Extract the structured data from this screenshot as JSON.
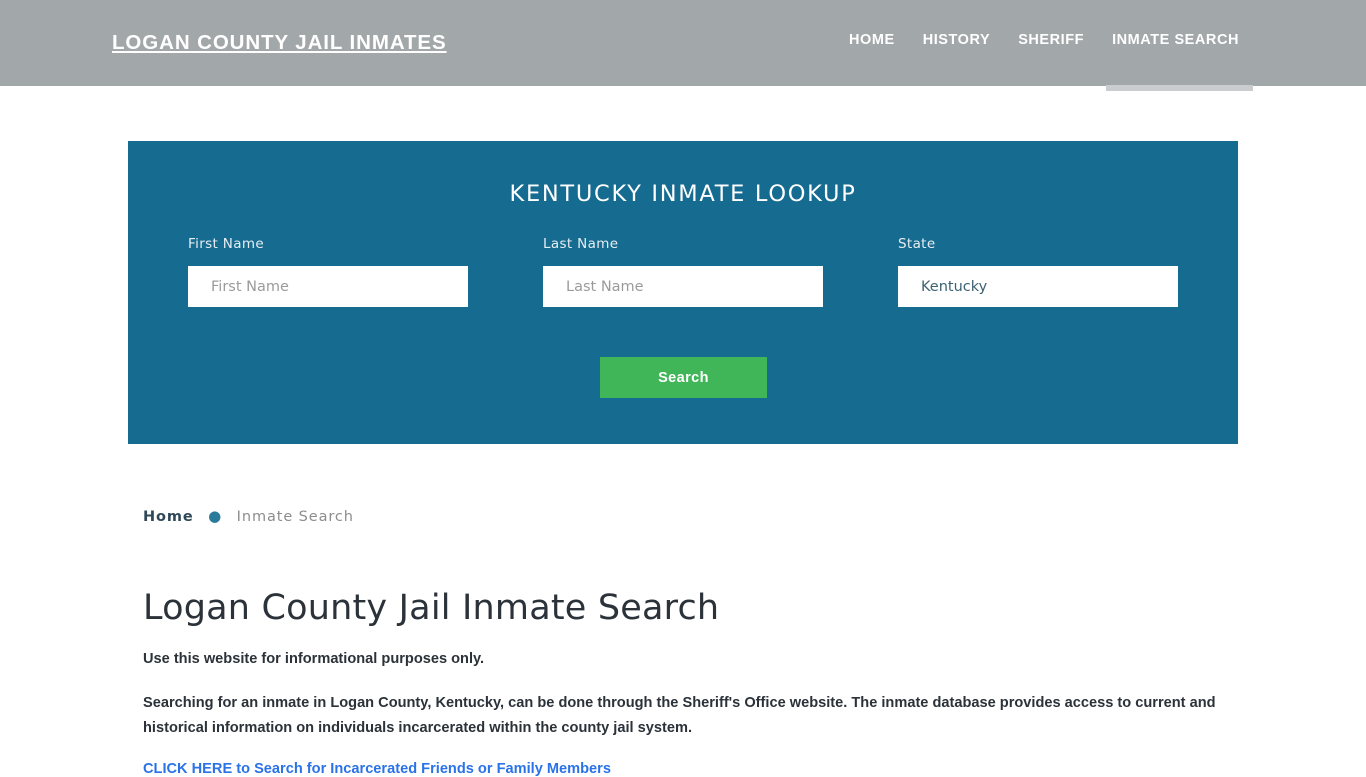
{
  "header": {
    "brand": "LOGAN COUNTY JAIL INMATES",
    "background_color": "#a2a7aa",
    "nav": [
      {
        "label": "HOME",
        "active": false
      },
      {
        "label": "HISTORY",
        "active": false
      },
      {
        "label": "SHERIFF",
        "active": false
      },
      {
        "label": "INMATE SEARCH",
        "active": true
      }
    ]
  },
  "lookup_panel": {
    "title": "KENTUCKY INMATE LOOKUP",
    "background_color": "#166b91",
    "fields": {
      "first_name": {
        "label": "First Name",
        "placeholder": "First Name",
        "value": ""
      },
      "last_name": {
        "label": "Last Name",
        "placeholder": "Last Name",
        "value": ""
      },
      "state": {
        "label": "State",
        "selected": "Kentucky",
        "options": [
          "Kentucky"
        ]
      }
    },
    "submit": {
      "label": "Search",
      "color": "#41b658"
    }
  },
  "breadcrumb": {
    "home": "Home",
    "separator": "●",
    "current": "Inmate Search"
  },
  "main": {
    "title": "Logan County Jail Inmate Search",
    "lede": "Use this website for informational purposes only.",
    "paragraph": "Searching for an inmate in Logan County, Kentucky, can be done through the Sheriff's Office website. The inmate database provides access to current and historical information on individuals incarcerated within the county jail system.",
    "cta_link": "CLICK HERE to Search for Incarcerated Friends or Family Members",
    "cta_link_color": "#2a72e8"
  }
}
